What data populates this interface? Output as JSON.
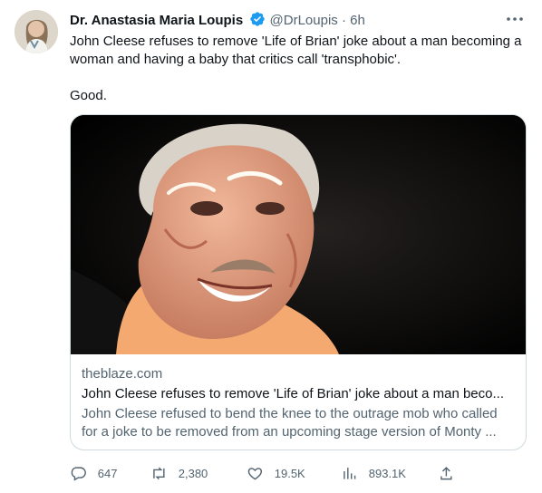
{
  "author": {
    "name": "Dr. Anastasia Maria Loupis",
    "handle": "@DrLoupis",
    "separator": "·",
    "time": "6h"
  },
  "tweet": {
    "text": "John Cleese refuses to remove 'Life of Brian' joke about a man becoming a woman and having a baby that critics call 'transphobic'.\n\nGood."
  },
  "card": {
    "domain": "theblaze.com",
    "title": "John Cleese refuses to remove 'Life of Brian' joke about a man beco...",
    "description": "John Cleese refused to bend the knee to the outrage mob who called for a joke to be removed from an upcoming stage version of Monty ..."
  },
  "actions": {
    "replies": "647",
    "retweets": "2,380",
    "likes": "19.5K",
    "views": "893.1K"
  },
  "colors": {
    "accent": "#1d9bf0",
    "muted": "#536471",
    "border": "#cfd9de"
  },
  "icons": [
    "verified-badge-icon",
    "more-icon",
    "reply-icon",
    "retweet-icon",
    "like-icon",
    "views-icon",
    "share-icon"
  ]
}
